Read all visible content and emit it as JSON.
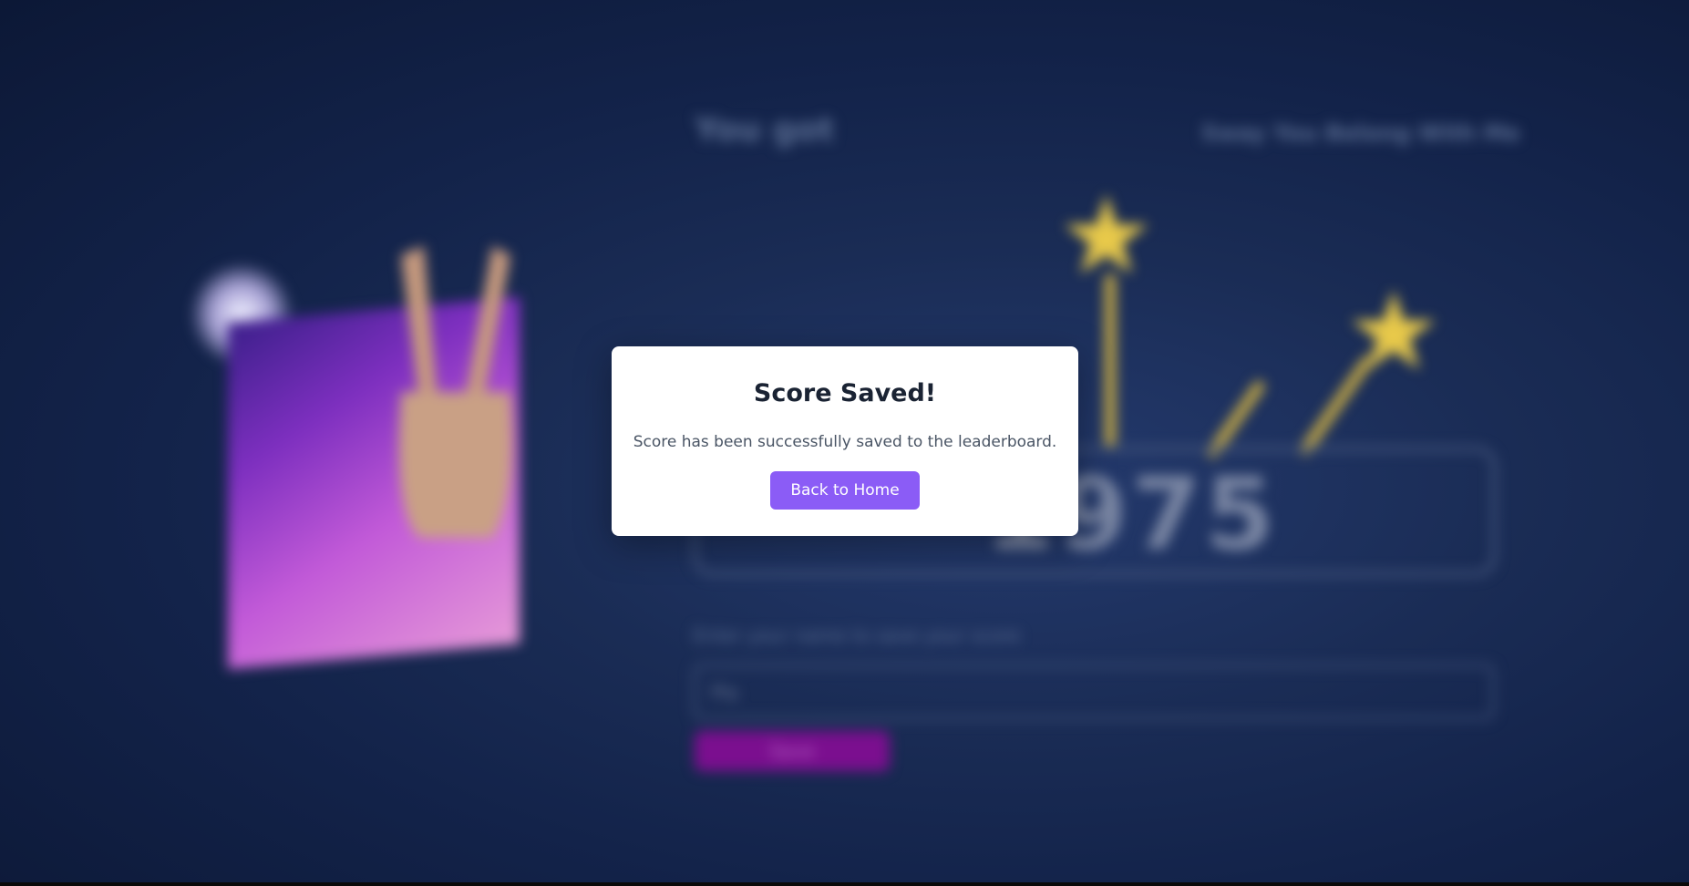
{
  "background": {
    "heading": "You got",
    "song": "Sway You Belong With Me",
    "score": "1975",
    "name_label": "Enter your name to save your score",
    "name_value": "Pla",
    "save_label": "Save"
  },
  "modal": {
    "title": "Score Saved!",
    "message": "Score has been successfully saved to the leaderboard.",
    "button_label": "Back to Home"
  },
  "colors": {
    "accent": "#8b5cf6",
    "background": "#13234a",
    "star": "#e8c94a"
  }
}
